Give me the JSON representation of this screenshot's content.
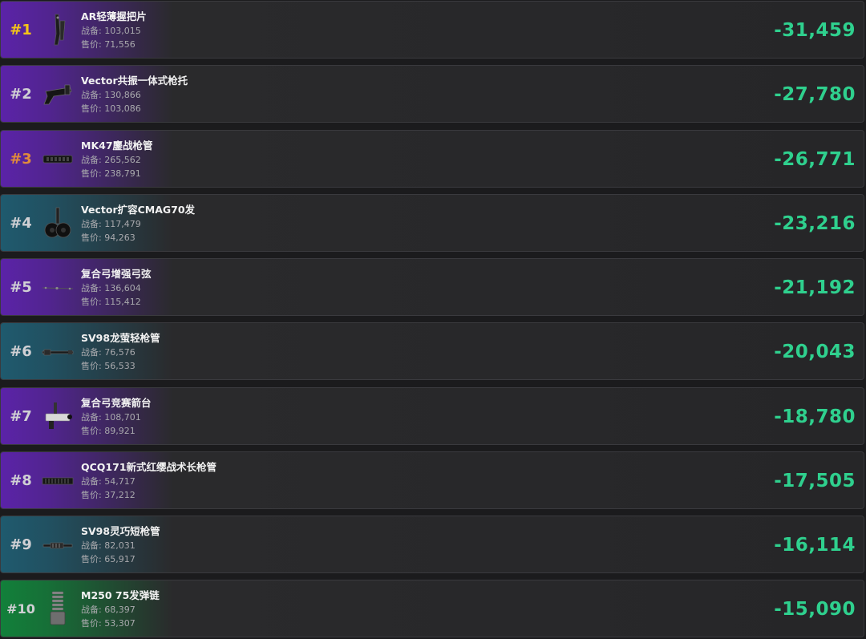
{
  "labels": {
    "cost_label": "战备:",
    "price_label": "售价:"
  },
  "colors": {
    "purple": "#5b23a8",
    "teal": "#1f5a6e",
    "green": "#12803a",
    "profit": "#2fd08e",
    "rank_gold": "#f5c518",
    "rank_orange": "#e08a3c",
    "rank_default": "#d0d0d4"
  },
  "items": [
    {
      "rank": "#1",
      "name": "AR轻薄握把片",
      "cost": "103,015",
      "price": "71,556",
      "profit": "-31,459",
      "color": "purple",
      "rank_color": "rank_gold",
      "icon": "grip-icon"
    },
    {
      "rank": "#2",
      "name": "Vector共振一体式枪托",
      "cost": "130,866",
      "price": "103,086",
      "profit": "-27,780",
      "color": "purple",
      "rank_color": "rank_default",
      "icon": "stock-icon"
    },
    {
      "rank": "#3",
      "name": "MK47鏖战枪管",
      "cost": "265,562",
      "price": "238,791",
      "profit": "-26,771",
      "color": "purple",
      "rank_color": "rank_orange",
      "icon": "barrel-icon"
    },
    {
      "rank": "#4",
      "name": "Vector扩容CMAG70发",
      "cost": "117,479",
      "price": "94,263",
      "profit": "-23,216",
      "color": "teal",
      "rank_color": "rank_default",
      "icon": "drum-magazine-icon"
    },
    {
      "rank": "#5",
      "name": "复合弓增强弓弦",
      "cost": "136,604",
      "price": "115,412",
      "profit": "-21,192",
      "color": "purple",
      "rank_color": "rank_default",
      "icon": "bowstring-icon"
    },
    {
      "rank": "#6",
      "name": "SV98龙萤轻枪管",
      "cost": "76,576",
      "price": "56,533",
      "profit": "-20,043",
      "color": "teal",
      "rank_color": "rank_default",
      "icon": "long-barrel-icon"
    },
    {
      "rank": "#7",
      "name": "复合弓竞赛箭台",
      "cost": "108,701",
      "price": "89,921",
      "profit": "-18,780",
      "color": "purple",
      "rank_color": "rank_default",
      "icon": "arrow-rest-icon"
    },
    {
      "rank": "#8",
      "name": "QCQ171新式红缨战术长枪管",
      "cost": "54,717",
      "price": "37,212",
      "profit": "-17,505",
      "color": "purple",
      "rank_color": "rank_default",
      "icon": "rail-barrel-icon"
    },
    {
      "rank": "#9",
      "name": "SV98灵巧短枪管",
      "cost": "82,031",
      "price": "65,917",
      "profit": "-16,114",
      "color": "teal",
      "rank_color": "rank_default",
      "icon": "short-barrel-icon"
    },
    {
      "rank": "#10",
      "name": "M250 75发弹链",
      "cost": "68,397",
      "price": "53,307",
      "profit": "-15,090",
      "color": "green",
      "rank_color": "rank_default",
      "icon": "ammo-belt-icon"
    }
  ]
}
